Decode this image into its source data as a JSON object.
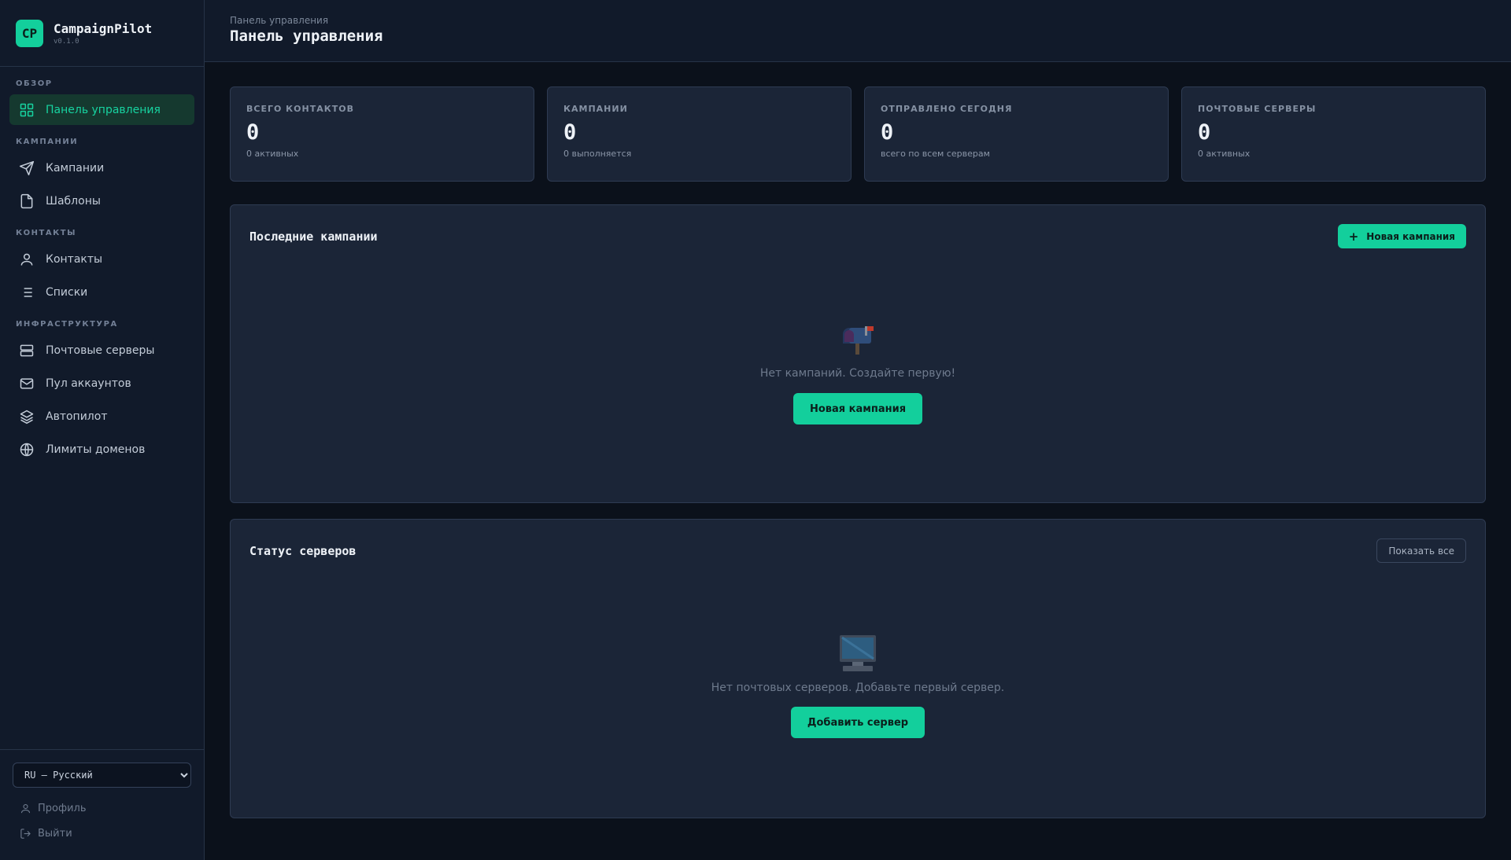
{
  "brand": {
    "logo": "CP",
    "name": "CampaignPilot",
    "version": "v0.1.0"
  },
  "nav": {
    "groups": [
      {
        "title": "ОБЗОР",
        "items": [
          {
            "label": "Панель управления",
            "icon": "dashboard-icon",
            "active": true
          }
        ]
      },
      {
        "title": "КАМПАНИИ",
        "items": [
          {
            "label": "Кампании",
            "icon": "send-icon"
          },
          {
            "label": "Шаблоны",
            "icon": "file-icon"
          }
        ]
      },
      {
        "title": "КОНТАКТЫ",
        "items": [
          {
            "label": "Контакты",
            "icon": "user-icon"
          },
          {
            "label": "Списки",
            "icon": "list-icon"
          }
        ]
      },
      {
        "title": "ИНФРАСТРУКТУРА",
        "items": [
          {
            "label": "Почтовые серверы",
            "icon": "server-icon"
          },
          {
            "label": "Пул аккаунтов",
            "icon": "mail-icon"
          },
          {
            "label": "Автопилот",
            "icon": "layers-icon"
          },
          {
            "label": "Лимиты доменов",
            "icon": "globe-icon"
          }
        ]
      }
    ]
  },
  "footer": {
    "language": "RU — Русский",
    "profile": "Профиль",
    "logout": "Выйти"
  },
  "header": {
    "breadcrumb": "Панель управления",
    "title": "Панель управления"
  },
  "stats": [
    {
      "label": "ВСЕГО КОНТАКТОВ",
      "value": "0",
      "sub": "0 активных"
    },
    {
      "label": "КАМПАНИИ",
      "value": "0",
      "sub": "0 выполняется"
    },
    {
      "label": "ОТПРАВЛЕНО СЕГОДНЯ",
      "value": "0",
      "sub": "всего по всем серверам"
    },
    {
      "label": "ПОЧТОВЫЕ СЕРВЕРЫ",
      "value": "0",
      "sub": "0 активных"
    }
  ],
  "campaigns": {
    "title": "Последние кампании",
    "new_button": "Новая кампания",
    "empty_icon": "mailbox-icon",
    "empty_text": "Нет кампаний. Создайте первую!",
    "empty_button": "Новая кампания"
  },
  "servers": {
    "title": "Статус серверов",
    "show_all": "Показать все",
    "empty_icon": "computer-icon",
    "empty_text": "Нет почтовых серверов. Добавьте первый сервер.",
    "empty_button": "Добавить сервер"
  },
  "colors": {
    "accent": "#13cf9c",
    "background": "#0b111b",
    "panel": "#1b2537",
    "sidebar": "#111a2a"
  }
}
